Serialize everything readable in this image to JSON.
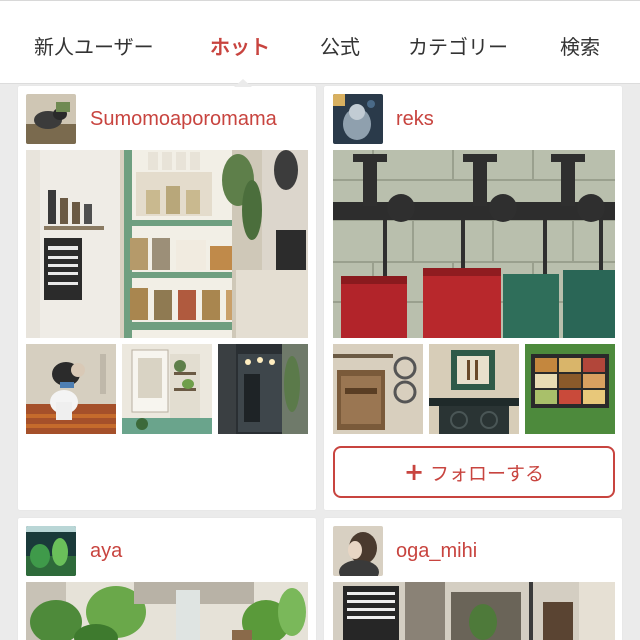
{
  "tabs": [
    {
      "label": "新人ユーザー",
      "active": false
    },
    {
      "label": "ホット",
      "active": true
    },
    {
      "label": "公式",
      "active": false
    },
    {
      "label": "カテゴリー",
      "active": false
    },
    {
      "label": "検索",
      "active": false
    }
  ],
  "feed": [
    {
      "username": "Sumomoaporomama",
      "avatar_icon": "dog-avatar-icon",
      "follow_label": null
    },
    {
      "username": "reks",
      "avatar_icon": "figure-avatar-icon",
      "follow_label": "フォローする"
    },
    {
      "username": "aya",
      "avatar_icon": "aquarium-avatar-icon",
      "follow_label": null
    },
    {
      "username": "oga_mihi",
      "avatar_icon": "person-avatar-icon",
      "follow_label": null
    }
  ],
  "colors": {
    "accent": "#c8443f",
    "background": "#ebebeb",
    "card": "#ffffff"
  }
}
